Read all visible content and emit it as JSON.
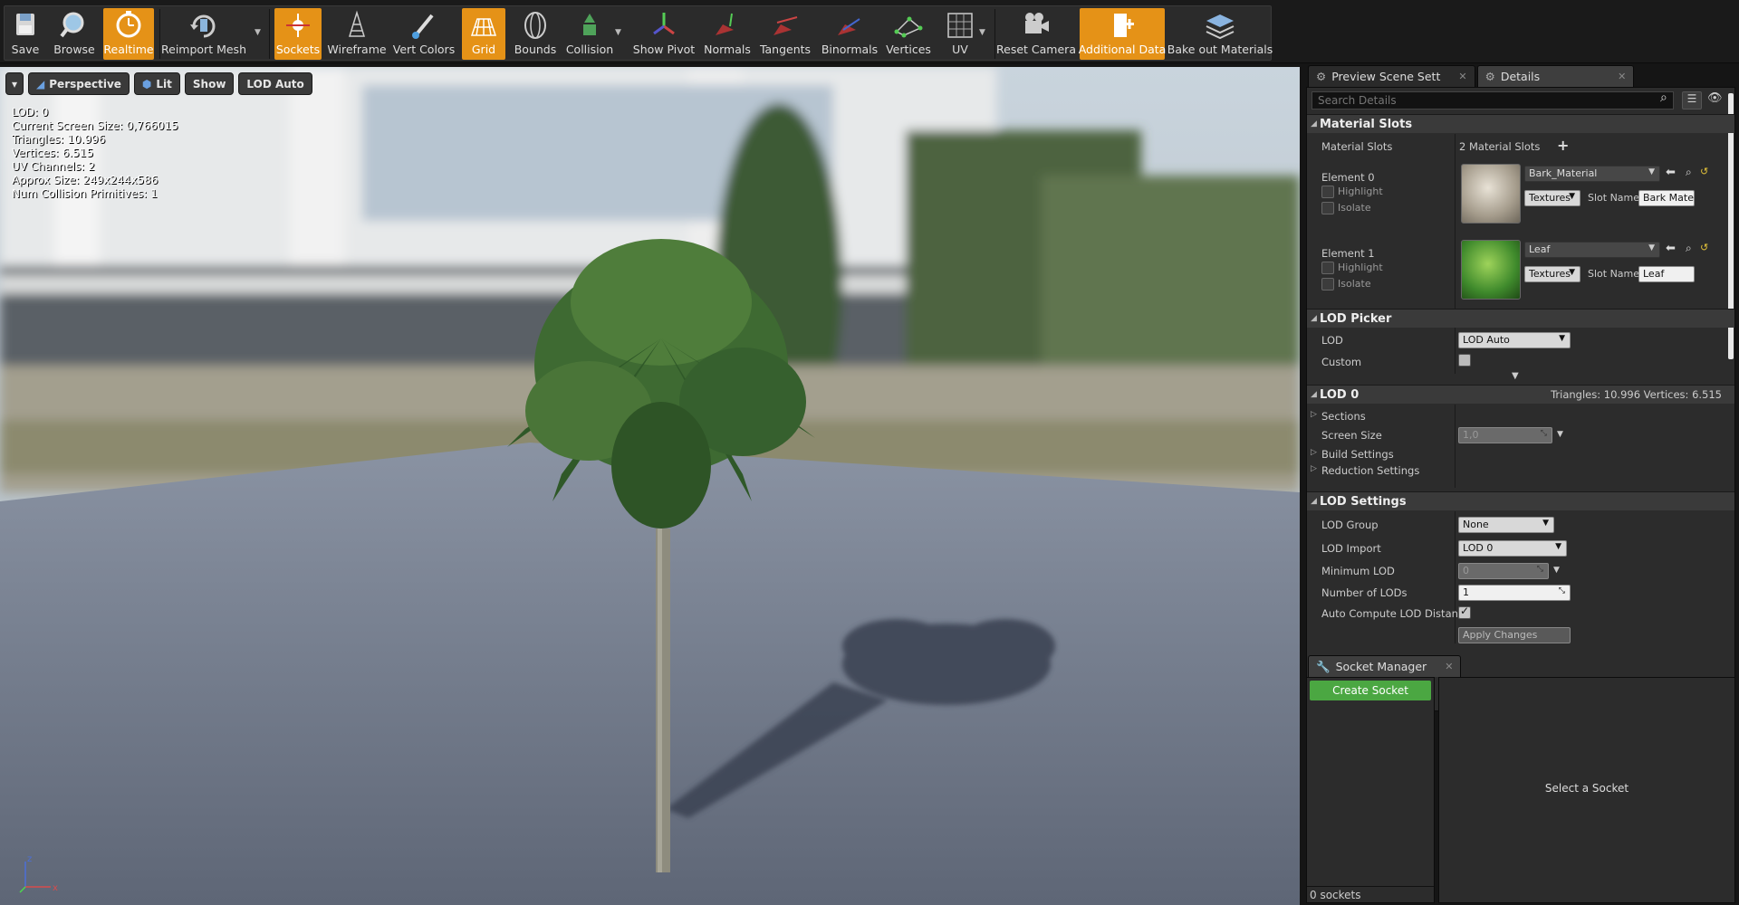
{
  "toolbar": {
    "buttons": [
      {
        "label": "Save",
        "icon": "save-icon"
      },
      {
        "label": "Browse",
        "icon": "browse-icon"
      },
      {
        "label": "Realtime",
        "icon": "realtime-icon",
        "active": true
      },
      {
        "label": "Reimport Mesh",
        "icon": "reimport-icon"
      },
      {
        "label": "Sockets",
        "icon": "sockets-icon",
        "active": true
      },
      {
        "label": "Wireframe",
        "icon": "wireframe-icon"
      },
      {
        "label": "Vert Colors",
        "icon": "vert-colors-icon"
      },
      {
        "label": "Grid",
        "icon": "grid-icon",
        "active": true
      },
      {
        "label": "Bounds",
        "icon": "bounds-icon"
      },
      {
        "label": "Collision",
        "icon": "collision-icon"
      },
      {
        "label": "Show Pivot",
        "icon": "pivot-icon"
      },
      {
        "label": "Normals",
        "icon": "normals-icon"
      },
      {
        "label": "Tangents",
        "icon": "tangents-icon"
      },
      {
        "label": "Binormals",
        "icon": "binormals-icon"
      },
      {
        "label": "Vertices",
        "icon": "vertices-icon"
      },
      {
        "label": "UV",
        "icon": "uv-icon"
      },
      {
        "label": "Reset Camera",
        "icon": "camera-icon"
      },
      {
        "label": "Additional Data",
        "icon": "additional-data-icon",
        "active": true
      },
      {
        "label": "Bake out Materials",
        "icon": "bake-icon"
      }
    ]
  },
  "viewport": {
    "buttons": {
      "perspective": "Perspective",
      "lit": "Lit",
      "show": "Show",
      "lod": "LOD Auto"
    },
    "stats": [
      "LOD:  0",
      "Current Screen Size:  0,766015",
      "Triangles:  10.996",
      "Vertices:  6.515",
      "UV Channels:  2",
      "Approx Size: 249x244x586",
      "Num Collision Primitives:  1"
    ]
  },
  "details": {
    "tabs": {
      "preview": "Preview Scene Sett",
      "details": "Details"
    },
    "search_placeholder": "Search Details",
    "material_slots": {
      "header": "Material Slots",
      "label": "Material Slots",
      "count": "2 Material Slots",
      "elements": [
        {
          "name": "Element 0",
          "material": "Bark_Material",
          "textures": "Textures",
          "slot_label": "Slot Name",
          "slot_name": "Bark Mate",
          "highlight": "Highlight",
          "isolate": "Isolate"
        },
        {
          "name": "Element 1",
          "material": "Leaf",
          "textures": "Textures",
          "slot_label": "Slot Name",
          "slot_name": "Leaf",
          "highlight": "Highlight",
          "isolate": "Isolate"
        }
      ]
    },
    "lod_picker": {
      "header": "LOD Picker",
      "lod_label": "LOD",
      "lod_value": "LOD Auto",
      "custom_label": "Custom"
    },
    "lod0": {
      "header": "LOD 0",
      "summary": "Triangles: 10.996   Vertices: 6.515",
      "sections": "Sections",
      "screen_size_label": "Screen Size",
      "screen_size_value": "1,0",
      "build_settings": "Build Settings",
      "reduction_settings": "Reduction Settings"
    },
    "lod_settings": {
      "header": "LOD Settings",
      "lod_group_label": "LOD Group",
      "lod_group_value": "None",
      "lod_import_label": "LOD Import",
      "lod_import_value": "LOD 0",
      "min_lod_label": "Minimum LOD",
      "min_lod_value": "0",
      "num_lods_label": "Number of LODs",
      "num_lods_value": "1",
      "auto_compute_label": "Auto Compute LOD Distance",
      "apply_changes": "Apply Changes"
    }
  },
  "socket_manager": {
    "tab": "Socket Manager",
    "create": "Create Socket",
    "count": "0 sockets",
    "select_hint": "Select a Socket"
  }
}
